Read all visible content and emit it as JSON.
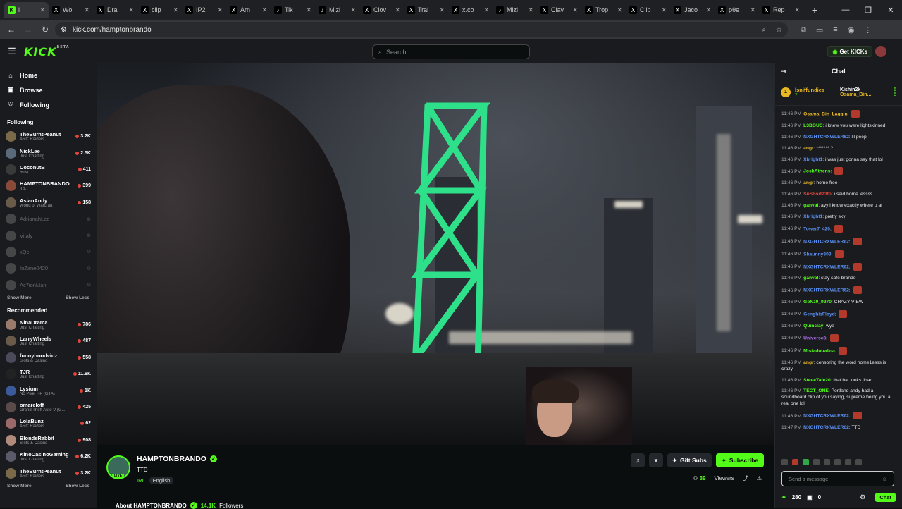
{
  "browser": {
    "tabs": [
      {
        "title": "l",
        "favicon": "K",
        "kind": "kick",
        "active": true
      },
      {
        "title": "Wo",
        "favicon": "X",
        "kind": "x"
      },
      {
        "title": "Dra",
        "favicon": "X",
        "kind": "x"
      },
      {
        "title": "clip",
        "favicon": "X",
        "kind": "x"
      },
      {
        "title": "IP2",
        "favicon": "X",
        "kind": "x"
      },
      {
        "title": "Arn",
        "favicon": "X",
        "kind": "x"
      },
      {
        "title": "Tik",
        "favicon": "♪",
        "kind": "tiktok"
      },
      {
        "title": "Mizi",
        "favicon": "♪",
        "kind": "tiktok"
      },
      {
        "title": "Clov",
        "favicon": "X",
        "kind": "x"
      },
      {
        "title": "Trai",
        "favicon": "X",
        "kind": "x"
      },
      {
        "title": "x.co",
        "favicon": "X",
        "kind": "x"
      },
      {
        "title": "Mizi",
        "favicon": "♪",
        "kind": "tiktok"
      },
      {
        "title": "Clav",
        "favicon": "X",
        "kind": "x"
      },
      {
        "title": "Trop",
        "favicon": "X",
        "kind": "x"
      },
      {
        "title": "Clip",
        "favicon": "X",
        "kind": "x"
      },
      {
        "title": "Jaco",
        "favicon": "X",
        "kind": "x"
      },
      {
        "title": "ρθe",
        "favicon": "X",
        "kind": "x"
      },
      {
        "title": "Rep",
        "favicon": "X",
        "kind": "x"
      }
    ],
    "url": "kick.com/hamptonbrando"
  },
  "header": {
    "logo": "KICK",
    "logo_sup": "BETA",
    "search_placeholder": "Search",
    "get_kicks": "Get KICKs"
  },
  "sidebar": {
    "nav": [
      {
        "label": "Home",
        "icon": "home-icon",
        "glyph": "⌂"
      },
      {
        "label": "Browse",
        "icon": "browse-icon",
        "glyph": "▣"
      },
      {
        "label": "Following",
        "icon": "heart-icon",
        "glyph": "♡"
      }
    ],
    "following_title": "Following",
    "following": [
      {
        "name": "TheBurntPeanut",
        "category": "ARC Raiders",
        "viewers": "3.2K",
        "color": "#7a6a4a"
      },
      {
        "name": "NickLee",
        "category": "Just Chatting",
        "viewers": "2.5K",
        "color": "#5a6a7a"
      },
      {
        "name": "CoconutB",
        "category": "Rust",
        "viewers": "411",
        "color": "#3a3a3a"
      },
      {
        "name": "HAMPTONBRANDO",
        "category": "IRL",
        "viewers": "399",
        "color": "#8a4a3a"
      },
      {
        "name": "AsianAndy",
        "category": "World of Warcraft",
        "viewers": "158",
        "color": "#6a5a4a"
      },
      {
        "name": "AdrianahLee",
        "category": "",
        "viewers": "",
        "color": "#888",
        "offline": true
      },
      {
        "name": "Vitaly",
        "category": "",
        "viewers": "",
        "color": "#888",
        "offline": true
      },
      {
        "name": "xQc",
        "category": "",
        "viewers": "",
        "color": "#888",
        "offline": true
      },
      {
        "name": "InZane0420",
        "category": "",
        "viewers": "",
        "color": "#888",
        "offline": true
      },
      {
        "name": "Ac7ionMan",
        "category": "",
        "viewers": "",
        "color": "#888",
        "offline": true
      }
    ],
    "show_more": "Show More",
    "show_less": "Show Less",
    "recommended_title": "Recommended",
    "recommended": [
      {
        "name": "NinaDrama",
        "category": "Just Chatting",
        "viewers": "786",
        "color": "#9a7a6a"
      },
      {
        "name": "LarryWheels",
        "category": "Just Chatting",
        "viewers": "487",
        "color": "#6a5a4a"
      },
      {
        "name": "funnyhoodvidz",
        "category": "Slots & Casino",
        "viewers": "558",
        "color": "#4a4a5a"
      },
      {
        "name": "TJR",
        "category": "Just Chatting",
        "viewers": "11.6K",
        "color": "#222"
      },
      {
        "name": "Lysium",
        "category": "No Pixel RP (GTA)",
        "viewers": "1K",
        "color": "#3a5a9a"
      },
      {
        "name": "omareloff",
        "category": "Grand Theft Auto V (G...",
        "viewers": "425",
        "color": "#5a4a4a"
      },
      {
        "name": "LolaBunz",
        "category": "ARC Raiders",
        "viewers": "62",
        "color": "#9a6a6a"
      },
      {
        "name": "BlondeRabbit",
        "category": "Slots & Casino",
        "viewers": "908",
        "color": "#b08a7a"
      },
      {
        "name": "KinoCasinoGaming",
        "category": "Just Chatting",
        "viewers": "6.2K",
        "color": "#5a5a6a"
      },
      {
        "name": "TheBurntPeanut",
        "category": "ARC Raiders",
        "viewers": "3.2K",
        "color": "#7a6a4a"
      }
    ]
  },
  "stream": {
    "name": "HAMPTONBRANDO",
    "title": "TTD",
    "category": "IRL",
    "language": "English",
    "live_label": "LIVE",
    "gift_subs": "Gift Subs",
    "subscribe": "Subscribe",
    "viewers_count": "39",
    "viewers_label": "Viewers",
    "about_label": "About HAMPTONBRANDO",
    "followers": "14.1K",
    "followers_label": "Followers"
  },
  "chat": {
    "title": "Chat",
    "pinned": {
      "badge": "1",
      "left_name": "lsniffundies",
      "left_count": "7",
      "right": [
        {
          "name": "Kishin2k",
          "count": "6"
        },
        {
          "name": "Osama_Bin...",
          "count": "6"
        }
      ]
    },
    "messages": [
      {
        "time": "11:46 PM",
        "user": "Osama_Bin_Laggin",
        "color": "#e8b923",
        "text": "",
        "emote": true
      },
      {
        "time": "11:46 PM",
        "user": "L3BOUC",
        "color": "#53fc18",
        "text": "i knew you were lightskinned"
      },
      {
        "time": "11:46 PM",
        "user": "NXGHTCRXWLER62",
        "color": "#5a8ff0",
        "text": "lil peep"
      },
      {
        "time": "11:46 PM",
        "user": "angr",
        "color": "#e8b923",
        "text": "******* ?"
      },
      {
        "time": "11:46 PM",
        "user": "Xbright1",
        "color": "#5a8ff0",
        "text": "i was just gonna say that lol"
      },
      {
        "time": "11:46 PM",
        "user": "JoshAthens",
        "color": "#53fc18",
        "text": "",
        "emote": true
      },
      {
        "time": "11:46 PM",
        "user": "angr",
        "color": "#e8b923",
        "text": "home free"
      },
      {
        "time": "11:46 PM",
        "user": "SuSFort23fp",
        "color": "#e3453b",
        "text": "i said home lessss"
      },
      {
        "time": "11:46 PM",
        "user": "ganval",
        "color": "#53fc18",
        "text": "ayy i know exactly where u at"
      },
      {
        "time": "11:46 PM",
        "user": "Xbright1",
        "color": "#5a8ff0",
        "text": "pretty sky"
      },
      {
        "time": "11:46 PM",
        "user": "Tower7_420",
        "color": "#5a8ff0",
        "text": "",
        "emote": true
      },
      {
        "time": "11:46 PM",
        "user": "NXGHTCRXWLER62",
        "color": "#5a8ff0",
        "text": "",
        "emote": true
      },
      {
        "time": "11:46 PM",
        "user": "Shaunny303",
        "color": "#5a8ff0",
        "text": "",
        "emote": true
      },
      {
        "time": "11:46 PM",
        "user": "NXGHTCRXWLER62",
        "color": "#5a8ff0",
        "text": "",
        "emote": true
      },
      {
        "time": "11:46 PM",
        "user": "ganval",
        "color": "#53fc18",
        "text": "stay safe brando"
      },
      {
        "time": "11:46 PM",
        "user": "NXGHTCRXWLER62",
        "color": "#5a8ff0",
        "text": "",
        "emote": true
      },
      {
        "time": "11:46 PM",
        "user": "GoNz0_9270",
        "color": "#53fc18",
        "text": "CRAZY VIEW"
      },
      {
        "time": "11:46 PM",
        "user": "GenghisFloyd",
        "color": "#5a8ff0",
        "text": "",
        "emote": true
      },
      {
        "time": "11:46 PM",
        "user": "Quinclay",
        "color": "#53fc18",
        "text": "wya"
      },
      {
        "time": "11:46 PM",
        "user": "Universe8",
        "color": "#b070f0",
        "text": "",
        "emote": true
      },
      {
        "time": "11:46 PM",
        "user": "Mistadobalina",
        "color": "#53fc18",
        "text": "",
        "emote": true
      },
      {
        "time": "11:46 PM",
        "user": "angr",
        "color": "#e8b923",
        "text": "censoring the word home1esss is crazy"
      },
      {
        "time": "11:46 PM",
        "user": "SteveTafe20",
        "color": "#53fc18",
        "text": "that hat looks jihad"
      },
      {
        "time": "11:46 PM",
        "user": "TECT_ONE",
        "color": "#53fc18",
        "text": "Portland andy had a soundboard clip of you saying, supreme being you a real one lol"
      },
      {
        "time": "11:46 PM",
        "user": "NXGHTCRXWLER62",
        "color": "#5a8ff0",
        "text": "",
        "emote": true
      },
      {
        "time": "11:47 PM",
        "user": "NXGHTCRXWLER62",
        "color": "#5a8ff0",
        "text": "TTD"
      }
    ],
    "input_placeholder": "Send a message",
    "points": "280",
    "kicks": "0",
    "send": "Chat"
  }
}
